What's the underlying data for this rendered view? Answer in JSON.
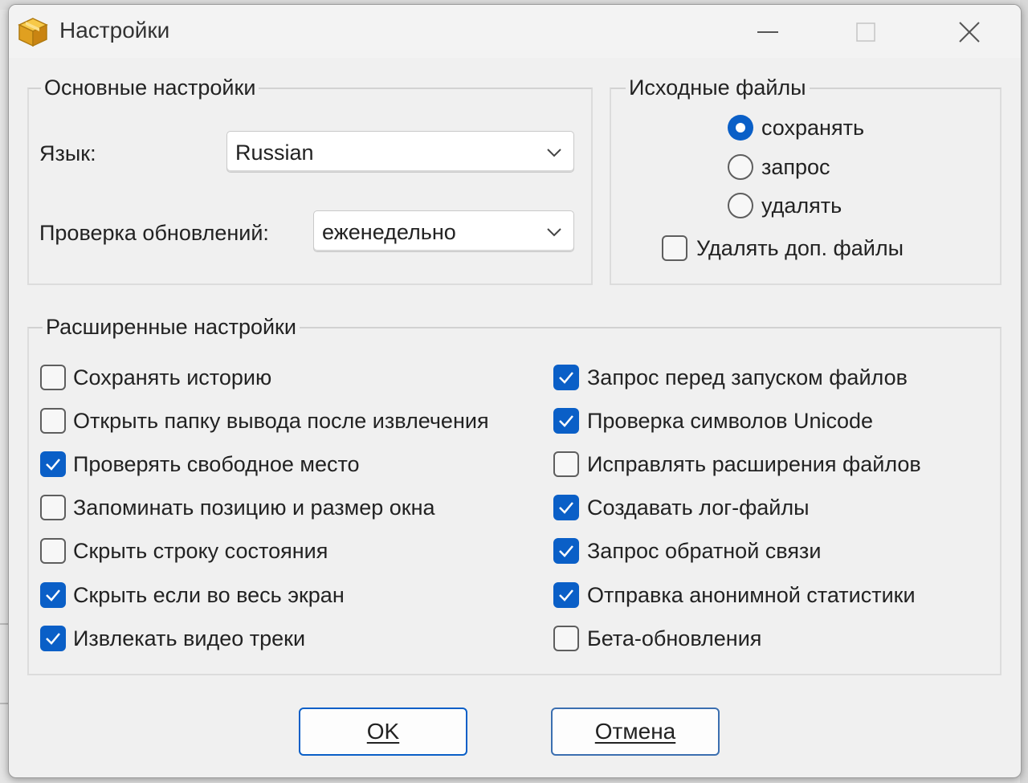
{
  "window": {
    "title": "Настройки",
    "icon": "package-box-icon"
  },
  "basic_settings": {
    "legend": "Основные настройки",
    "language_label": "Язык:",
    "language_value": "Russian",
    "update_check_label": "Проверка обновлений:",
    "update_check_value": "еженедельно"
  },
  "source_files": {
    "legend": "Исходные файлы",
    "options": [
      {
        "label": "сохранять",
        "checked": true
      },
      {
        "label": "запрос",
        "checked": false
      },
      {
        "label": "удалять",
        "checked": false
      }
    ],
    "delete_extra_label": "Удалять доп. файлы",
    "delete_extra_checked": false
  },
  "advanced_settings": {
    "legend": "Расширенные настройки",
    "left": [
      {
        "label": "Сохранять историю",
        "checked": false
      },
      {
        "label": "Открыть папку вывода после извлечения",
        "checked": false
      },
      {
        "label": "Проверять свободное место",
        "checked": true
      },
      {
        "label": "Запоминать позицию и размер окна",
        "checked": false
      },
      {
        "label": "Скрыть строку состояния",
        "checked": false
      },
      {
        "label": "Скрыть если во весь экран",
        "checked": true
      },
      {
        "label": "Извлекать видео треки",
        "checked": true
      }
    ],
    "right": [
      {
        "label": "Запрос перед запуском файлов",
        "checked": true
      },
      {
        "label": "Проверка символов Unicode",
        "checked": true
      },
      {
        "label": "Исправлять расширения файлов",
        "checked": false
      },
      {
        "label": "Создавать лог-файлы",
        "checked": true
      },
      {
        "label": "Запрос обратной связи",
        "checked": true
      },
      {
        "label": "Отправка анонимной статистики",
        "checked": true
      },
      {
        "label": "Бета-обновления",
        "checked": false
      }
    ]
  },
  "buttons": {
    "ok": "OK",
    "cancel": "Отмена"
  },
  "colors": {
    "accent": "#0a5fc7",
    "window_bg": "#f0f0f0"
  }
}
